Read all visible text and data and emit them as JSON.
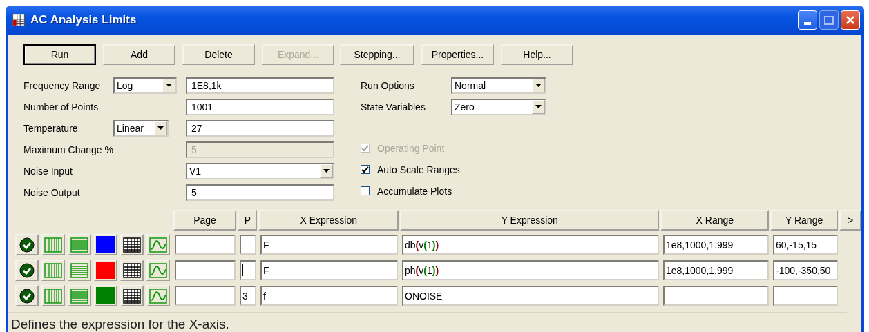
{
  "window": {
    "title": "AC Analysis Limits"
  },
  "buttons": [
    {
      "label": "Run",
      "default": true,
      "disabled": false
    },
    {
      "label": "Add",
      "default": false,
      "disabled": false
    },
    {
      "label": "Delete",
      "default": false,
      "disabled": false
    },
    {
      "label": "Expand...",
      "default": false,
      "disabled": true
    },
    {
      "label": "Stepping...",
      "default": false,
      "disabled": false
    },
    {
      "label": "Properties...",
      "default": false,
      "disabled": false
    },
    {
      "label": "Help...",
      "default": false,
      "disabled": false
    }
  ],
  "settings": [
    {
      "label": "Frequency Range",
      "kind": "text",
      "mode": "Log",
      "value": "1E8,1k",
      "disabled": false
    },
    {
      "label": "Number of Points",
      "kind": "text",
      "value": "1001",
      "disabled": false
    },
    {
      "label": "Temperature",
      "kind": "text",
      "mode": "Linear",
      "value": "27",
      "disabled": false
    },
    {
      "label": "Maximum Change %",
      "kind": "text",
      "value": "5",
      "disabled": true
    },
    {
      "label": "Noise Input",
      "kind": "combo",
      "value": "V1",
      "disabled": false
    },
    {
      "label": "Noise Output",
      "kind": "text",
      "value": "5",
      "disabled": false
    }
  ],
  "options": [
    {
      "label": "Run Options",
      "value": "Normal"
    },
    {
      "label": "State Variables",
      "value": "Zero"
    }
  ],
  "checks": [
    {
      "label": "Operating Point",
      "checked": true,
      "disabled": true
    },
    {
      "label": "Auto Scale Ranges",
      "checked": true,
      "disabled": false
    },
    {
      "label": "Accumulate Plots",
      "checked": false,
      "disabled": false
    }
  ],
  "table": {
    "columns": [
      "Page",
      "P",
      "X Expression",
      "Y Expression",
      "X Range",
      "Y Range"
    ],
    "more": ">",
    "rows": [
      {
        "color": "#0000ff",
        "p_focused": false,
        "x_expression": "F",
        "y_expression": "db(v(1))",
        "x_range": "1e8,1000,1.999",
        "y_range": "60,-15,15"
      },
      {
        "color": "#ff0000",
        "p_focused": true,
        "x_expression": "F",
        "y_expression": "ph(v(1))",
        "x_range": "1e8,1000,1.999",
        "y_range": "-100,-350,50"
      },
      {
        "color": "#008000",
        "p_focused": false,
        "p": "3",
        "x_expression": "f",
        "y_expression": "ONOISE"
      }
    ]
  },
  "status_bar": "Defines the expression for the X-axis."
}
